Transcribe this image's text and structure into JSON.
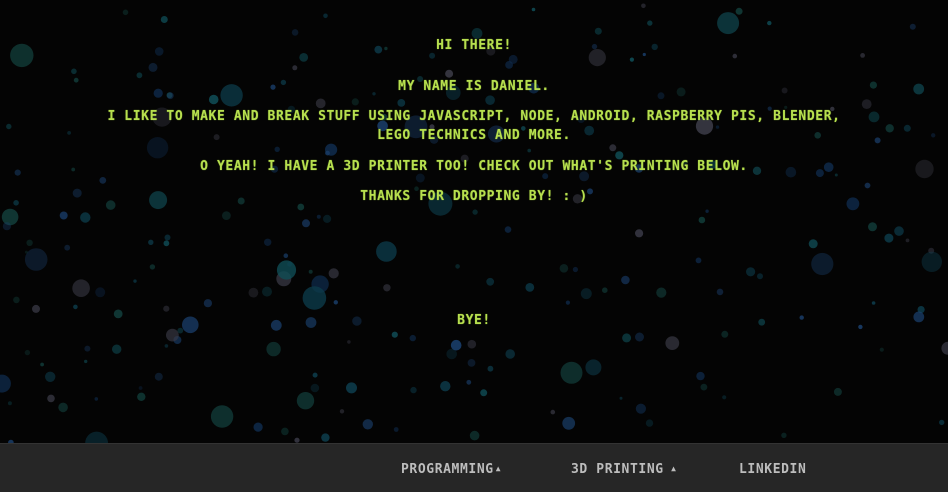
{
  "intro": {
    "greeting": "HI THERE!",
    "name": "MY NAME IS DANIEL.",
    "likes_line1": "I LIKE TO MAKE AND BREAK STUFF USING JAVASCRIPT, NODE, ANDROID, RASPBERRY PIS, BLENDER,",
    "likes_line2": "LEGO TECHNICS AND MORE.",
    "printer": "O YEAH! I HAVE A 3D PRINTER TOO! CHECK OUT WHAT'S PRINTING BELOW.",
    "thanks": "THANKS FOR DROPPING BY! : )",
    "bye": "BYE!"
  },
  "nav": {
    "programming": "PROGRAMMING",
    "printing": "3D PRINTING",
    "linkedin": "LINKEDIN",
    "caret_icon": "caret-up-icon"
  },
  "colors": {
    "text": "#b7df4f",
    "background": "#040404",
    "footer": "#262626",
    "bubble_palette": [
      "#0f2a4a",
      "#0d3b4a",
      "#123d3a",
      "#3a3a46",
      "#1a3e6a",
      "#104c55"
    ]
  }
}
